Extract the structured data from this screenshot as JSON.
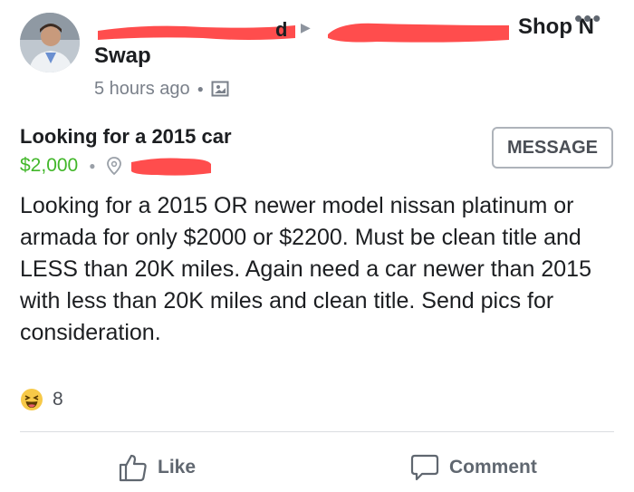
{
  "post": {
    "group_name_part1": "Shop N",
    "group_name_part2": "Swap",
    "arrow": "▶",
    "time": "5 hours ago",
    "more": "•••"
  },
  "listing": {
    "title": "Looking for a 2015 car",
    "price": "$2,000",
    "message_button": "MESSAGE",
    "description": "Looking for a 2015 OR newer model nissan platinum or armada for only $2000 or $2200. Must be clean title and LESS than 20K miles. Again need a car newer than 2015 with less than 20K miles and clean title. Send pics for consideration."
  },
  "reactions": {
    "count": "8",
    "icon": "haha-emoji-icon"
  },
  "actions": {
    "like_label": "Like",
    "comment_label": "Comment"
  },
  "colors": {
    "price_green": "#42b72a",
    "redaction": "#ff4d4d"
  }
}
